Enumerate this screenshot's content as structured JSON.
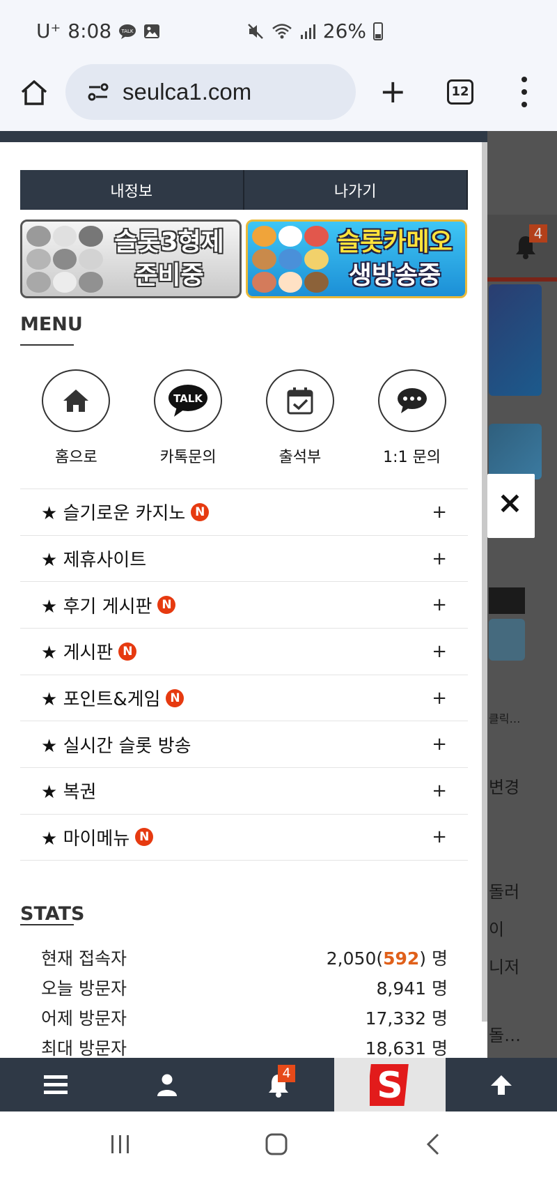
{
  "status_bar": {
    "carrier": "U⁺",
    "time": "8:08",
    "battery": "26%"
  },
  "browser": {
    "url": "seulca1.com",
    "tab_count": "12"
  },
  "drawer": {
    "buttons": [
      {
        "label": "내정보"
      },
      {
        "label": "나가기"
      }
    ],
    "promos": [
      {
        "line1": "슬롯3형제",
        "line2": "준비중"
      },
      {
        "line1": "슬롯카메오",
        "line2": "생방송중"
      }
    ],
    "menu_title": "MENU",
    "quick_icons": [
      {
        "label": "홈으로",
        "icon": "home-icon"
      },
      {
        "label": "카톡문의",
        "icon": "kakaotalk-icon",
        "talk_text": "TALK"
      },
      {
        "label": "출석부",
        "icon": "calendar-check-icon"
      },
      {
        "label": "1:1 문의",
        "icon": "chat-bubble-icon"
      }
    ],
    "menu_items": [
      {
        "label": "★ 슬기로운 카지노",
        "badge": "N",
        "expand": "+"
      },
      {
        "label": "★ 제휴사이트",
        "badge": "",
        "expand": "+"
      },
      {
        "label": "★ 후기 게시판",
        "badge": "N",
        "expand": "+"
      },
      {
        "label": "★ 게시판",
        "badge": "N",
        "expand": "+"
      },
      {
        "label": "★ 포인트&게임",
        "badge": "N",
        "expand": "+"
      },
      {
        "label": "★ 실시간 슬롯 방송",
        "badge": "",
        "expand": "+"
      },
      {
        "label": "★ 복권",
        "badge": "",
        "expand": "+"
      },
      {
        "label": "★ 마이메뉴",
        "badge": "N",
        "expand": "+"
      }
    ],
    "stats_title": "STATS",
    "stats": [
      {
        "label": "현재 접속자",
        "value": "2,050(",
        "highlight": "592",
        "suffix": ") 명"
      },
      {
        "label": "오늘 방문자",
        "value": "8,941 명",
        "highlight": "",
        "suffix": ""
      },
      {
        "label": "어제 방문자",
        "value": "17,332 명",
        "highlight": "",
        "suffix": ""
      },
      {
        "label": "최대 방문자",
        "value": "18,631 명",
        "highlight": "",
        "suffix": ""
      }
    ]
  },
  "background_page": {
    "notification_count": "4",
    "close_label": "×",
    "snippets": [
      "클릭…",
      "변경",
      "돌러",
      "이",
      "니저",
      "돌…"
    ]
  },
  "bottom_nav": {
    "notification_count": "4",
    "logo_letter": "S"
  },
  "colors": {
    "drawer_header": "#2f3946",
    "badge": "#e63a10",
    "highlight": "#e0601a"
  }
}
